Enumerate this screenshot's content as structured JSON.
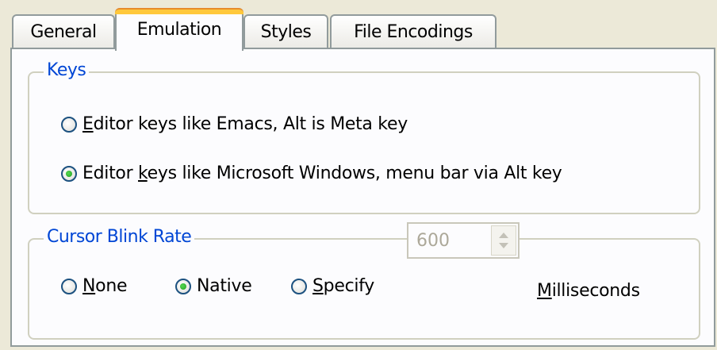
{
  "tabs": [
    {
      "label": "General",
      "active": false
    },
    {
      "label": "Emulation",
      "active": true
    },
    {
      "label": "Styles",
      "active": false
    },
    {
      "label": "File Encodings",
      "active": false
    }
  ],
  "keys_group": {
    "title": "Keys",
    "options": [
      {
        "label_prefix": "",
        "mnemonic": "E",
        "label_suffix": "ditor keys like Emacs, Alt is Meta key",
        "checked": false
      },
      {
        "label_prefix": "Editor ",
        "mnemonic": "k",
        "label_suffix": "eys like Microsoft Windows, menu bar via Alt key",
        "checked": true
      }
    ]
  },
  "blink_group": {
    "title": "Cursor Blink Rate",
    "options": [
      {
        "mnemonic": "N",
        "label_suffix": "one",
        "checked": false
      },
      {
        "mnemonic": "",
        "label_suffix": "Native",
        "checked": true
      },
      {
        "mnemonic": "S",
        "label_suffix": "pecify",
        "checked": false
      }
    ],
    "spinner_value": "600",
    "unit_mnemonic": "M",
    "unit_suffix": "illiseconds"
  },
  "colors": {
    "accent_blue": "#0046d5",
    "tab_highlight": "#ffc83c",
    "radio_checked": "#21a121"
  }
}
